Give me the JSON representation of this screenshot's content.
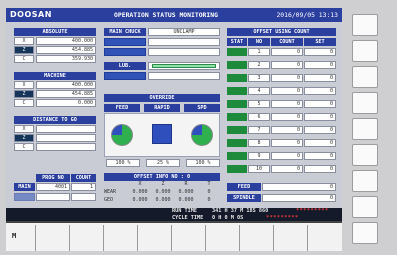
{
  "header": {
    "brand": "DOOSAN",
    "title": "OPERATION STATUS MONITORING",
    "datetime": "2016/09/05 13:13"
  },
  "absolute": {
    "title": "ABSOLUTE",
    "rows": [
      {
        "axis": "X",
        "value": "400.000"
      },
      {
        "axis": "Z",
        "value": "454.885"
      },
      {
        "axis": "C",
        "value": "359.930"
      }
    ]
  },
  "machine": {
    "title": "MACHINE",
    "rows": [
      {
        "axis": "X",
        "value": "400.000"
      },
      {
        "axis": "Z",
        "value": "454.885"
      },
      {
        "axis": "C",
        "value": "0.000"
      }
    ]
  },
  "distance": {
    "title": "DISTANCE TO GO",
    "rows": [
      {
        "axis": "X",
        "value": ""
      },
      {
        "axis": "Z",
        "value": ""
      },
      {
        "axis": "C",
        "value": ""
      }
    ]
  },
  "prog": {
    "headers": [
      "PROG NO",
      "COUNT"
    ],
    "row_label": "MAIN",
    "prog_no": "4001",
    "count": "1"
  },
  "chuck": {
    "label": "MAIN CHUCK",
    "status": "UNCLAMP",
    "lub_label": "LUB."
  },
  "override": {
    "title": "OVERRIDE",
    "labels": [
      "FEED",
      "RAPID",
      "SPD"
    ],
    "values": [
      "100 %",
      "25 %",
      "100 %"
    ],
    "feed_fraction": 0.75,
    "spd_fraction": 0.75
  },
  "offset_info": {
    "title": "OFFSET INFO NO : 0",
    "cols": [
      "X",
      "Z",
      "R",
      "T"
    ],
    "rows": [
      {
        "label": "WEAR",
        "values": [
          "0.000",
          "0.000",
          "0.000",
          "0"
        ]
      },
      {
        "label": "GEO",
        "values": [
          "0.000",
          "0.000",
          "0.000",
          "0"
        ]
      }
    ]
  },
  "offset_count": {
    "title": "OFFSET USING COUNT",
    "headers": [
      "STAT",
      "NO",
      "COUNT",
      "SET"
    ],
    "rows": [
      {
        "no": "1",
        "count": "0",
        "set": "0"
      },
      {
        "no": "2",
        "count": "0",
        "set": "0"
      },
      {
        "no": "3",
        "count": "0",
        "set": "0"
      },
      {
        "no": "4",
        "count": "0",
        "set": "0"
      },
      {
        "no": "5",
        "count": "0",
        "set": "0"
      },
      {
        "no": "6",
        "count": "0",
        "set": "0"
      },
      {
        "no": "7",
        "count": "0",
        "set": "0"
      },
      {
        "no": "8",
        "count": "0",
        "set": "0"
      },
      {
        "no": "9",
        "count": "0",
        "set": "0"
      },
      {
        "no": "10",
        "count": "0",
        "set": "0"
      }
    ]
  },
  "feed": {
    "label": "FEED",
    "value": "0"
  },
  "spindle": {
    "label": "SPINDLE",
    "value": "0"
  },
  "run": {
    "run_label": "RUN TIME",
    "run_value": "341 H 37 M 18S 860",
    "run_stars": "*********",
    "cycle_label": "CYCLE TIME",
    "cycle_value": "0 H 0 M 0S",
    "cycle_stars": "*********"
  },
  "softkeys": {
    "first": "M"
  },
  "colors": {
    "title_bar": "#2b3f9e",
    "status_green": "#1e8a3c",
    "selected_axis": "#16355a"
  }
}
